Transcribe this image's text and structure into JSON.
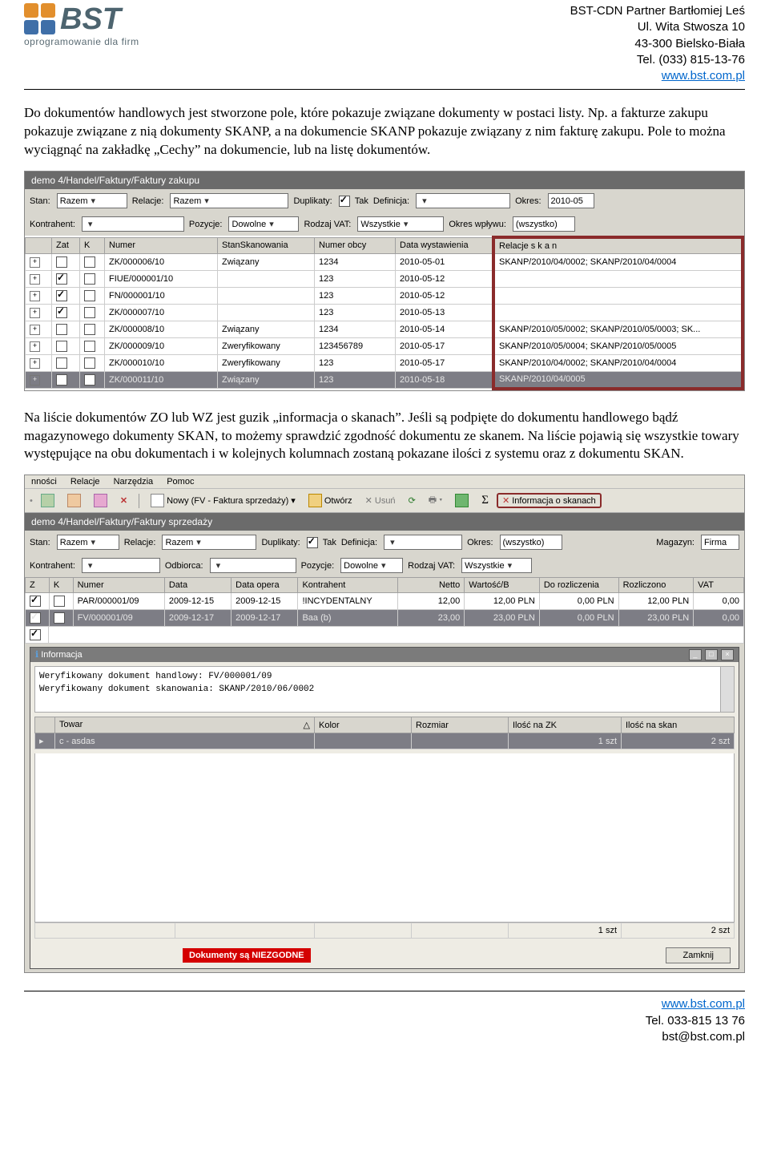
{
  "logo": {
    "main": "BST",
    "sub": "oprogramowanie dla firm",
    "sq_colors": [
      "#e28f2d",
      "#e28f2d",
      "#3f6fa8",
      "#3f6fa8"
    ]
  },
  "company": {
    "l1": "BST-CDN Partner Bartłomiej Leś",
    "l2": "Ul. Wita Stwosza 10",
    "l3": "43-300 Bielsko-Biała",
    "l4": "Tel. (033) 815-13-76",
    "link": "www.bst.com.pl"
  },
  "para1": "Do dokumentów handlowych jest stworzone pole, które pokazuje związane dokumenty w postaci listy. Np. a fakturze zakupu pokazuje związane z nią dokumenty SKANP, a na dokumencie SKANP pokazuje związany z nim fakturę zakupu. Pole to można wyciągnąć na zakładkę „Cechy” na dokumencie, lub na listę dokumentów.",
  "para2": "Na liście dokumentów ZO lub WZ jest guzik „informacja o skanach”. Jeśli są podpięte do dokumentu handlowego bądź magazynowego dokumenty SKAN,  to możemy  sprawdzić zgodność dokumentu ze skanem. Na liście pojawią się wszystkie towary występujące na obu dokumentach i w kolejnych kolumnach zostaną pokazane ilości z systemu oraz z dokumentu SKAN.",
  "shot1": {
    "title": "demo 4/Handel/Faktury/Faktury zakupu",
    "filters": {
      "stan_lbl": "Stan:",
      "stan": "Razem",
      "rel_lbl": "Relacje:",
      "rel": "Razem",
      "dup_lbl": "Duplikaty:",
      "dup_txt": "Tak",
      "def_lbl": "Definicja:",
      "def": "",
      "okres_lbl": "Okres:",
      "okres": "2010-05",
      "kontr_lbl": "Kontrahent:",
      "kontr": "",
      "poz_lbl": "Pozycje:",
      "poz": "Dowolne",
      "vat_lbl": "Rodzaj VAT:",
      "vat": "Wszystkie",
      "okrw_lbl": "Okres wpływu:",
      "okrw": "(wszystko)"
    },
    "cols": {
      "zat": "Zat",
      "k": "K",
      "numer": "Numer",
      "stan": "StanSkanowania",
      "nobcy": "Numer obcy",
      "data": "Data wystawienia",
      "rel": "Relacje s k a n"
    },
    "rows": [
      {
        "zat": false,
        "k": false,
        "num": "ZK/000006/10",
        "stan": "Związany",
        "obc": "1234",
        "data": "2010-05-01",
        "rel": "SKANP/2010/04/0002; SKANP/2010/04/0004"
      },
      {
        "zat": true,
        "k": false,
        "num": "FIUE/000001/10",
        "stan": "",
        "obc": "123",
        "data": "2010-05-12",
        "rel": ""
      },
      {
        "zat": true,
        "k": false,
        "num": "FN/000001/10",
        "stan": "",
        "obc": "123",
        "data": "2010-05-12",
        "rel": ""
      },
      {
        "zat": true,
        "k": false,
        "num": "ZK/000007/10",
        "stan": "",
        "obc": "123",
        "data": "2010-05-13",
        "rel": ""
      },
      {
        "zat": false,
        "k": false,
        "num": "ZK/000008/10",
        "stan": "Związany",
        "obc": "1234",
        "data": "2010-05-14",
        "rel": "SKANP/2010/05/0002; SKANP/2010/05/0003; SK..."
      },
      {
        "zat": false,
        "k": false,
        "num": "ZK/000009/10",
        "stan": "Zweryfikowany",
        "obc": "123456789",
        "data": "2010-05-17",
        "rel": "SKANP/2010/05/0004; SKANP/2010/05/0005"
      },
      {
        "zat": false,
        "k": false,
        "num": "ZK/000010/10",
        "stan": "Zweryfikowany",
        "obc": "123",
        "data": "2010-05-17",
        "rel": "SKANP/2010/04/0002; SKANP/2010/04/0004"
      },
      {
        "zat": false,
        "k": false,
        "num": "ZK/000011/10",
        "stan": "Związany",
        "obc": "123",
        "data": "2010-05-18",
        "rel": "SKANP/2010/04/0005",
        "sel": true
      }
    ]
  },
  "shot2": {
    "menus": [
      "nności",
      "Relacje",
      "Narzędzia",
      "Pomoc"
    ],
    "toolbar": {
      "nowy": "Nowy (FV - Faktura sprzedaży)",
      "otworz": "Otwórz",
      "usun": "Usuń",
      "info": "Informacja o skanach"
    },
    "title": "demo 4/Handel/Faktury/Faktury sprzedaży",
    "filters": {
      "stan_lbl": "Stan:",
      "stan": "Razem",
      "rel_lbl": "Relacje:",
      "rel": "Razem",
      "dup_lbl": "Duplikaty:",
      "dup_txt": "Tak",
      "def_lbl": "Definicja:",
      "def": "",
      "okres_lbl": "Okres:",
      "okres": "(wszystko)",
      "mag_lbl": "Magazyn:",
      "mag": "Firma",
      "kontr_lbl": "Kontrahent:",
      "kontr": "",
      "odb_lbl": "Odbiorca:",
      "odb": "",
      "poz_lbl": "Pozycje:",
      "poz": "Dowolne",
      "vat_lbl": "Rodzaj VAT:",
      "vat": "Wszystkie"
    },
    "cols": {
      "z": "Z",
      "k": "K",
      "numer": "Numer",
      "data": "Data",
      "dop": "Data opera",
      "kontr": "Kontrahent",
      "netto": "Netto",
      "wart": "Wartość/B",
      "doroz": "Do rozliczenia",
      "rozl": "Rozliczono",
      "vat": "VAT"
    },
    "rows": [
      {
        "z": true,
        "k": false,
        "num": "PAR/000001/09",
        "data": "2009-12-15",
        "dop": "2009-12-15",
        "kontr": "!INCYDENTALNY",
        "netto": "12,00",
        "wart": "12,00 PLN",
        "doroz": "0,00 PLN",
        "rozl": "12,00 PLN",
        "vat": "0,00"
      },
      {
        "z": true,
        "k": false,
        "num": "FV/000001/09",
        "data": "2009-12-17",
        "dop": "2009-12-17",
        "kontr": "Baa (b)",
        "netto": "23,00",
        "wart": "23,00 PLN",
        "doroz": "0,00 PLN",
        "rozl": "23,00 PLN",
        "vat": "0,00",
        "sel": true
      }
    ],
    "info": {
      "title": "Informacja",
      "l1": "Weryfikowany dokument handlowy: FV/000001/09",
      "l2": "Weryfikowany dokument skanowania: SKANP/2010/06/0002"
    },
    "tcols": {
      "towar": "Towar",
      "kolor": "Kolor",
      "rozm": "Rozmiar",
      "izk": "Ilość na ZK",
      "iskan": "Ilość na skan"
    },
    "trow": {
      "towar": "c - asdas",
      "izk": "1 szt",
      "iskan": "2 szt"
    },
    "tsum": {
      "izk": "1 szt",
      "iskan": "2 szt"
    },
    "status": "Dokumenty są NIEZGODNE",
    "close": "Zamknij"
  },
  "footer": {
    "link": "www.bst.com.pl",
    "tel": "Tel. 033-815 13 76",
    "mail": "bst@bst.com.pl"
  }
}
